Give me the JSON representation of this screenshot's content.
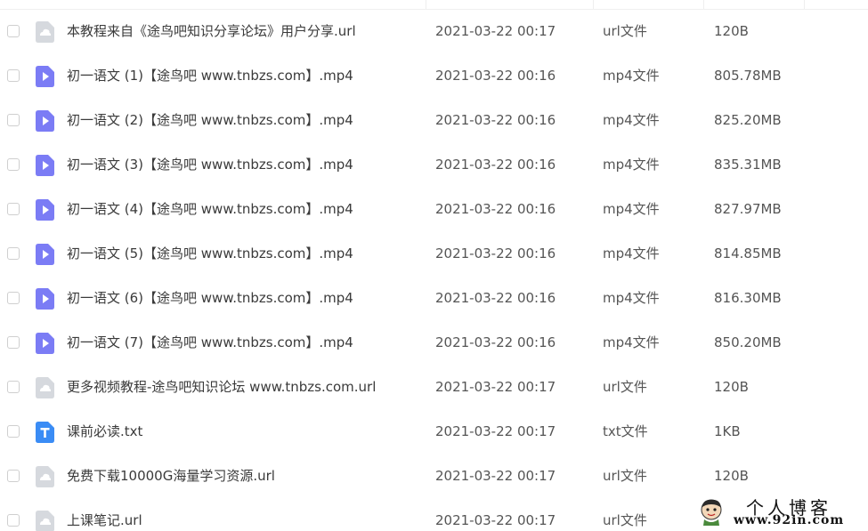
{
  "files": [
    {
      "name": "本教程来自《途鸟吧知识分享论坛》用户分享.url",
      "date": "2021-03-22 00:17",
      "type": "url文件",
      "size": "120B",
      "icon": "url-file-icon"
    },
    {
      "name": "初一语文 (1)【途鸟吧 www.tnbzs.com】.mp4",
      "date": "2021-03-22 00:16",
      "type": "mp4文件",
      "size": "805.78MB",
      "icon": "video-file-icon"
    },
    {
      "name": "初一语文 (2)【途鸟吧 www.tnbzs.com】.mp4",
      "date": "2021-03-22 00:16",
      "type": "mp4文件",
      "size": "825.20MB",
      "icon": "video-file-icon"
    },
    {
      "name": "初一语文 (3)【途鸟吧 www.tnbzs.com】.mp4",
      "date": "2021-03-22 00:16",
      "type": "mp4文件",
      "size": "835.31MB",
      "icon": "video-file-icon"
    },
    {
      "name": "初一语文 (4)【途鸟吧 www.tnbzs.com】.mp4",
      "date": "2021-03-22 00:16",
      "type": "mp4文件",
      "size": "827.97MB",
      "icon": "video-file-icon"
    },
    {
      "name": "初一语文 (5)【途鸟吧 www.tnbzs.com】.mp4",
      "date": "2021-03-22 00:16",
      "type": "mp4文件",
      "size": "814.85MB",
      "icon": "video-file-icon"
    },
    {
      "name": "初一语文 (6)【途鸟吧 www.tnbzs.com】.mp4",
      "date": "2021-03-22 00:16",
      "type": "mp4文件",
      "size": "816.30MB",
      "icon": "video-file-icon"
    },
    {
      "name": "初一语文 (7)【途鸟吧 www.tnbzs.com】.mp4",
      "date": "2021-03-22 00:16",
      "type": "mp4文件",
      "size": "850.20MB",
      "icon": "video-file-icon"
    },
    {
      "name": "更多视频教程-途鸟吧知识论坛 www.tnbzs.com.url",
      "date": "2021-03-22 00:17",
      "type": "url文件",
      "size": "120B",
      "icon": "url-file-icon"
    },
    {
      "name": "课前必读.txt",
      "date": "2021-03-22 00:17",
      "type": "txt文件",
      "size": "1KB",
      "icon": "text-file-icon"
    },
    {
      "name": "免费下载10000G海量学习资源.url",
      "date": "2021-03-22 00:17",
      "type": "url文件",
      "size": "120B",
      "icon": "url-file-icon"
    },
    {
      "name": "上课笔记.url",
      "date": "2021-03-22 00:17",
      "type": "url文件",
      "size": "",
      "icon": "url-file-icon"
    }
  ],
  "watermark": {
    "title": "个人博客",
    "url": "www.92in.com"
  },
  "colors": {
    "video_icon": "#7b7cf5",
    "text_icon": "#3a8cf5",
    "url_icon": "#d6d9de",
    "text": "#3a3a3a",
    "muted_text": "#555555"
  }
}
